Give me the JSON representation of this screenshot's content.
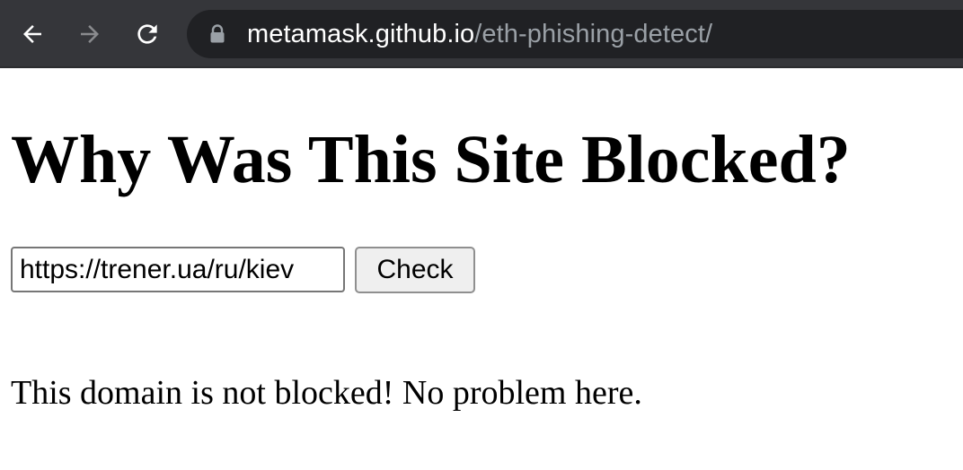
{
  "browser": {
    "url_host": "metamask.github.io",
    "url_path": "/eth-phishing-detect/",
    "icons": {
      "back": "back-arrow-icon",
      "forward": "forward-arrow-icon",
      "reload": "reload-icon",
      "lock": "lock-icon"
    },
    "colors": {
      "toolbar": "#35363a",
      "omnibox": "#202124",
      "host_text": "#ffffff",
      "path_text": "#9aa0a6"
    }
  },
  "page": {
    "title": "Why Was This Site Blocked?",
    "check_input_value": "https://trener.ua/ru/kiev",
    "check_button_label": "Check",
    "result_message": "This domain is not blocked! No problem here."
  }
}
